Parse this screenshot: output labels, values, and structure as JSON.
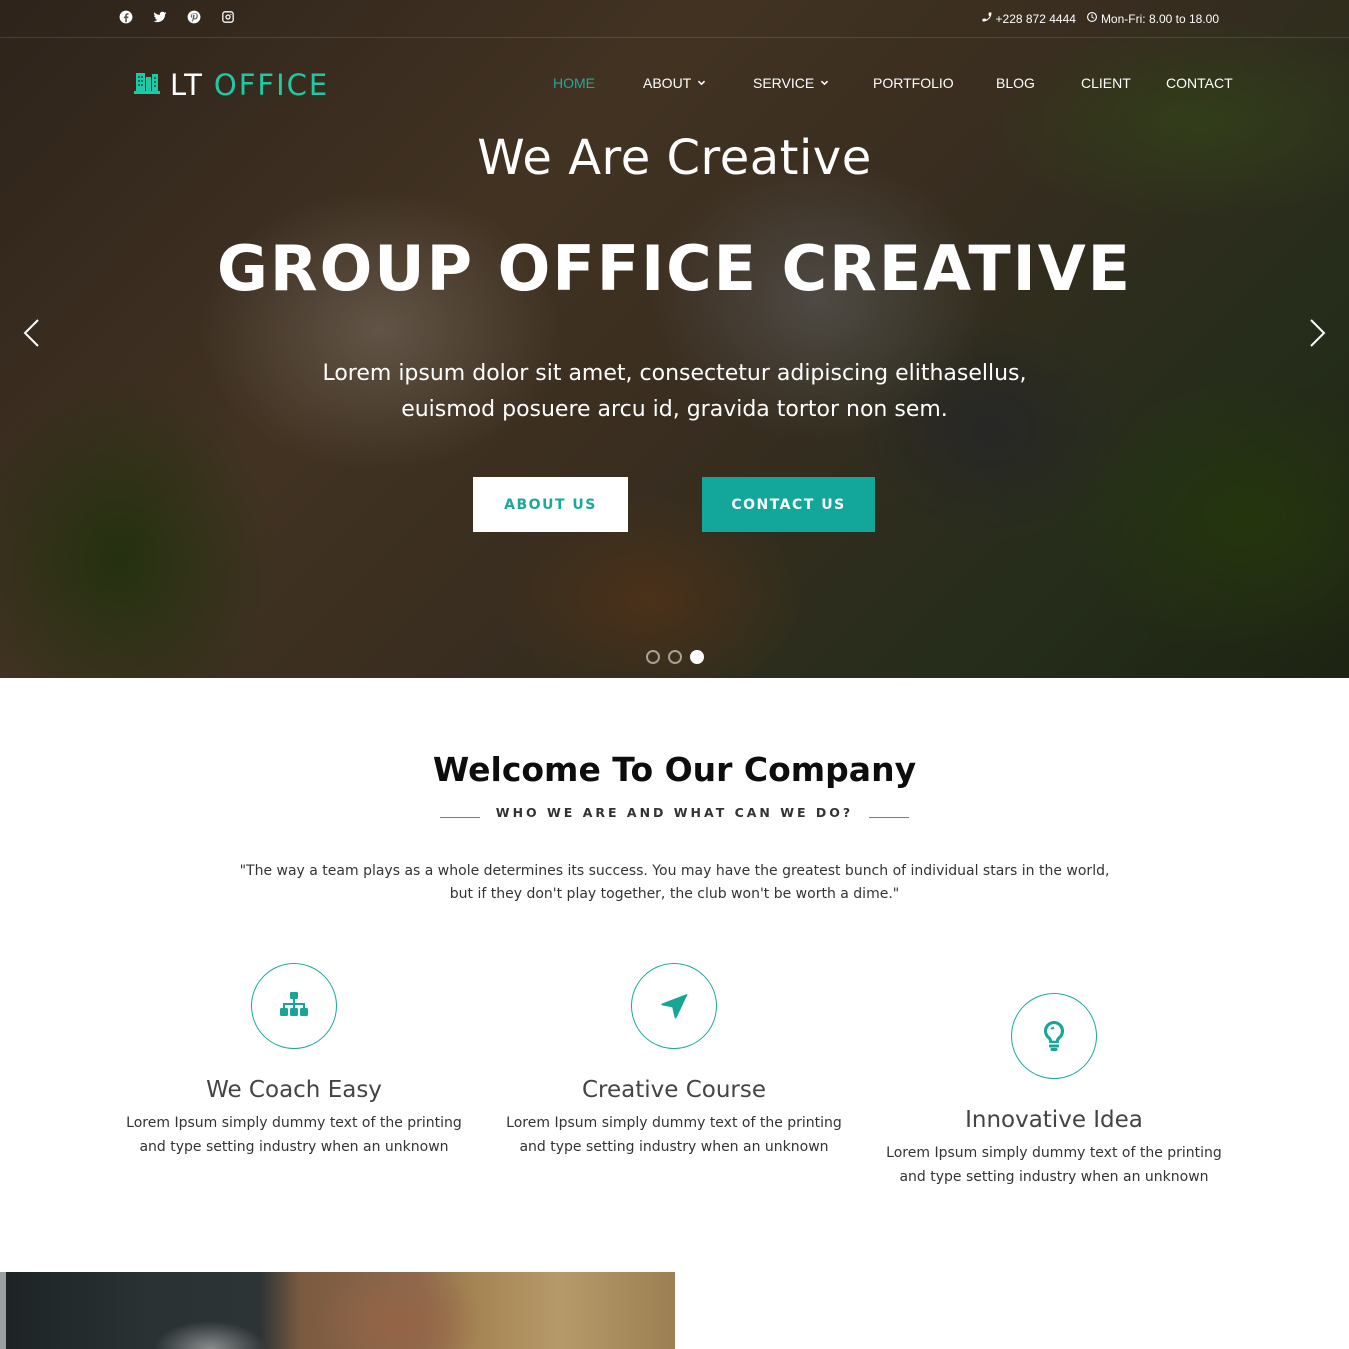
{
  "topbar": {
    "social": [
      {
        "icon": "facebook-icon",
        "label": "Facebook"
      },
      {
        "icon": "twitter-icon",
        "label": "Twitter"
      },
      {
        "icon": "pinterest-icon",
        "label": "Pinterest"
      },
      {
        "icon": "instagram-icon",
        "label": "Instagram"
      }
    ],
    "phone": "+228 872 4444",
    "hours": "Mon-Fri: 8.00 to 18.00"
  },
  "brand": {
    "part1": "LT",
    "part2": "OFFICE",
    "accent_color": "#1ec9a5"
  },
  "nav": {
    "items": [
      {
        "label": "HOME",
        "active": true,
        "has_dropdown": false
      },
      {
        "label": "ABOUT",
        "active": false,
        "has_dropdown": true
      },
      {
        "label": "SERVICE",
        "active": false,
        "has_dropdown": true
      },
      {
        "label": "PORTFOLIO",
        "active": false,
        "has_dropdown": false
      },
      {
        "label": "BLOG",
        "active": false,
        "has_dropdown": false
      },
      {
        "label": "CLIENT",
        "active": false,
        "has_dropdown": false
      },
      {
        "label": "CONTACT",
        "active": false,
        "has_dropdown": false
      }
    ],
    "active_color": "#22a99c"
  },
  "hero": {
    "tagline": "We Are Creative",
    "title": "GROUP OFFICE CREATIVE",
    "description_line1": "Lorem ipsum dolor sit amet, consectetur adipiscing elithasellus,",
    "description_line2": "euismod posuere arcu id, gravida tortor non sem.",
    "about_button": "ABOUT US",
    "contact_button": "CONTACT US",
    "slides_total": 3,
    "active_slide": 3,
    "primary_color": "#12a79a"
  },
  "welcome": {
    "title": "Welcome To Our Company",
    "subtitle": "WHO WE ARE AND WHAT CAN WE DO?",
    "quote_line1": "\"The way a team plays as a whole determines its success. You may have the greatest bunch of individual stars in the world,",
    "quote_line2": "but if they don't play together, the club won't be worth a dime.\""
  },
  "features": [
    {
      "icon": "sitemap-icon",
      "title": "We Coach Easy",
      "text_line1": "Lorem Ipsum simply dummy text of the printing",
      "text_line2": "and type setting industry when an unknown"
    },
    {
      "icon": "location-arrow-icon",
      "title": "Creative Course",
      "text_line1": "Lorem Ipsum simply dummy text of the printing",
      "text_line2": "and type setting industry when an unknown"
    },
    {
      "icon": "lightbulb-icon",
      "title": "Innovative Idea",
      "text_line1": "Lorem Ipsum simply dummy text of the printing",
      "text_line2": "and type setting industry when an unknown"
    }
  ]
}
